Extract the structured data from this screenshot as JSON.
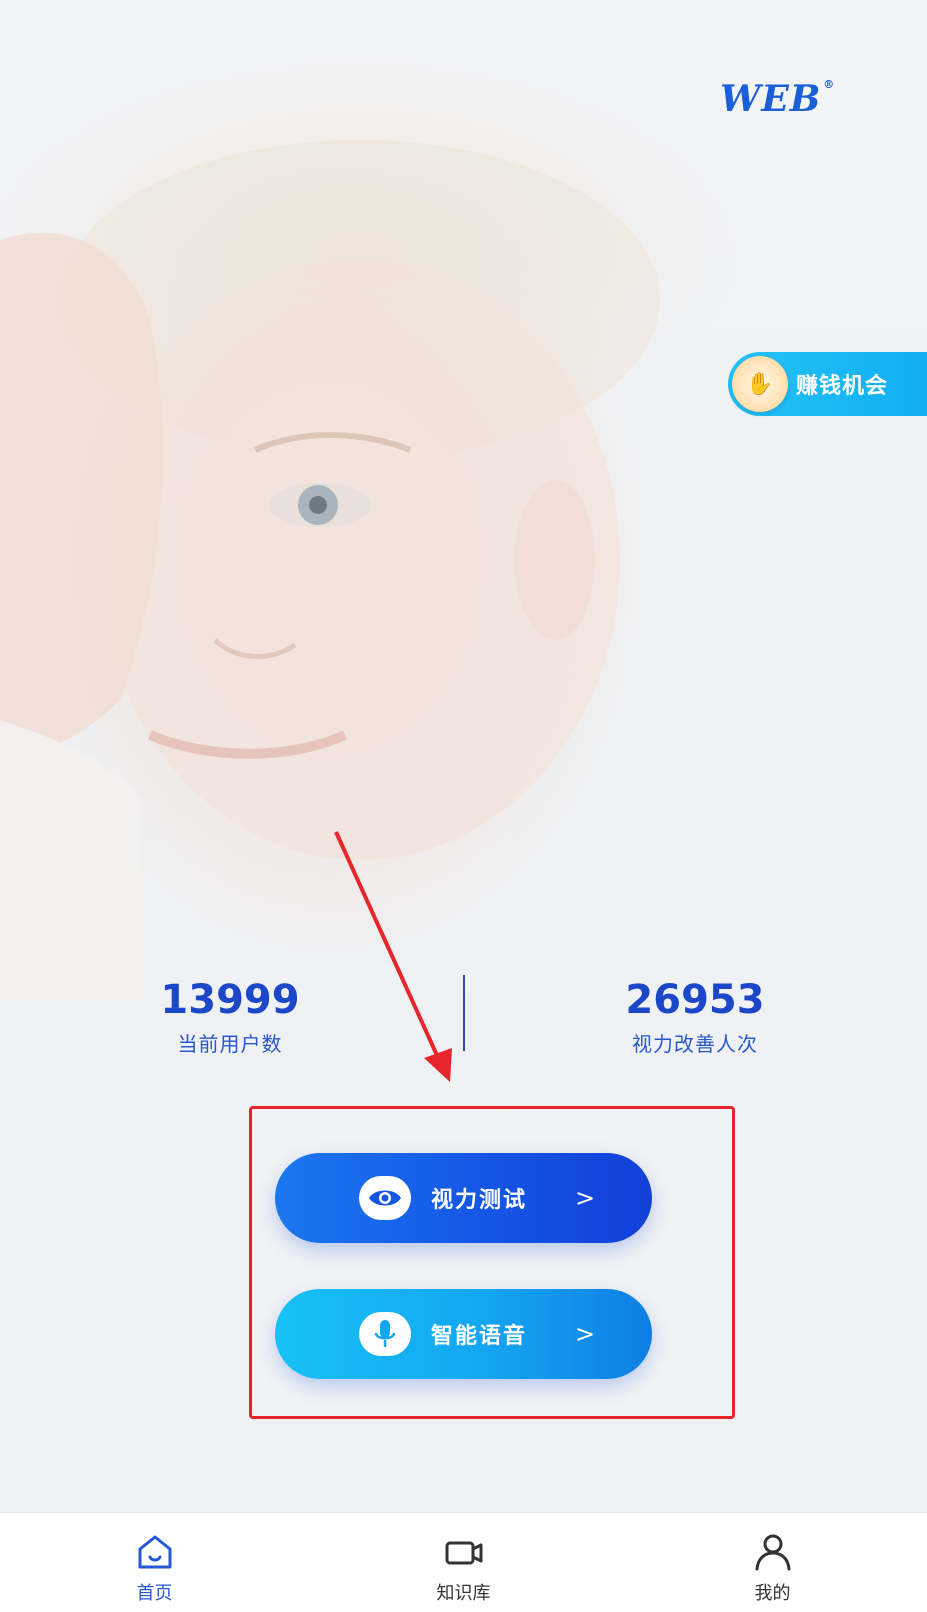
{
  "app": {
    "logo": "WEB",
    "logo_mark": "®"
  },
  "promo": {
    "label": "赚钱机会",
    "icon": "coin-hand-icon"
  },
  "stats": [
    {
      "value": "13999",
      "label": "当前用户数"
    },
    {
      "value": "26953",
      "label": "视力改善人次"
    }
  ],
  "actions": [
    {
      "label": "视力测试",
      "icon": "eye-icon",
      "chevron": ">"
    },
    {
      "label": "智能语音",
      "icon": "microphone-icon",
      "chevron": ">"
    }
  ],
  "tabs": [
    {
      "label": "首页",
      "icon": "home-icon",
      "active": true
    },
    {
      "label": "知识库",
      "icon": "video-camera-icon",
      "active": false
    },
    {
      "label": "我的",
      "icon": "user-icon",
      "active": false
    }
  ],
  "colors": {
    "primary": "#1b47c8",
    "accent_cyan": "#11aef0",
    "highlight_red": "#e6262a",
    "tab_active": "#2458d6"
  }
}
